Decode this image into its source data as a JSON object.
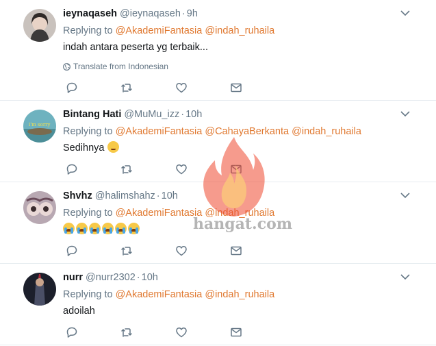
{
  "tweets": [
    {
      "name": "ieynaqaseh",
      "handle": "@ieynaqaseh",
      "time": "9h",
      "replying_prefix": "Replying to",
      "mentions": [
        "@AkademiFantasia",
        "@indah_ruhaila"
      ],
      "text": "indah antara peserta yg terbaik...",
      "translate": "Translate from Indonesian"
    },
    {
      "name": "Bintang Hati",
      "handle": "@MuMu_izz",
      "time": "10h",
      "replying_prefix": "Replying to",
      "mentions": [
        "@AkademiFantasia",
        "@CahayaBerkanta",
        "@indah_ruhaila"
      ],
      "text": "Sedihnya",
      "emoji": "relieved-face"
    },
    {
      "name": "Shvhz",
      "handle": "@halimshahz",
      "time": "10h",
      "replying_prefix": "Replying to",
      "mentions": [
        "@AkademiFantasia",
        "@indah_ruhaila"
      ],
      "emoji": "loudly-crying-face",
      "emoji_count": 6
    },
    {
      "name": "nurr",
      "handle": "@nurr2302",
      "time": "10h",
      "replying_prefix": "Replying to",
      "mentions": [
        "@AkademiFantasia",
        "@indah_ruhaila"
      ],
      "text": "adoilah"
    }
  ],
  "icons": [
    "reply-icon",
    "retweet-icon",
    "like-icon",
    "dm-icon",
    "chevron-down-icon",
    "globe-icon"
  ],
  "watermark": {
    "text": "hangat.com"
  },
  "colors": {
    "mention": "#e0782f",
    "muted": "#657786",
    "icon": "#657786",
    "border": "#e6ecf0"
  }
}
